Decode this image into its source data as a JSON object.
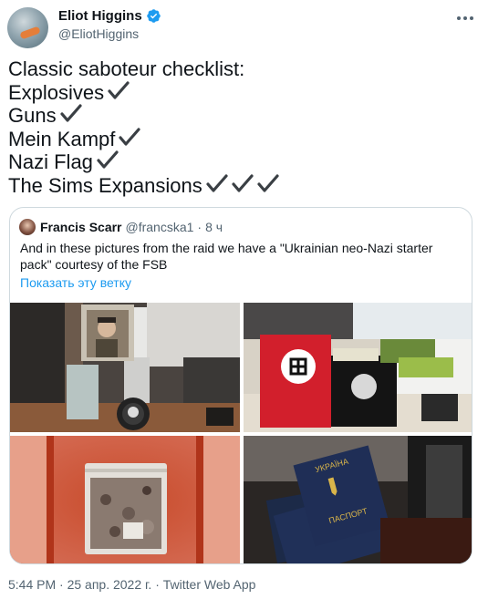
{
  "author": {
    "display_name": "Eliot Higgins",
    "handle": "@EliotHiggins",
    "verified": true,
    "more_icon": "more-horizontal-icon"
  },
  "tweet": {
    "lines": [
      {
        "text": "Classic saboteur checklist:",
        "checks": 0
      },
      {
        "text": "Explosives",
        "checks": 1
      },
      {
        "text": "Guns",
        "checks": 1
      },
      {
        "text": "Mein Kampf",
        "checks": 1
      },
      {
        "text": "Nazi Flag",
        "checks": 1
      },
      {
        "text": "The Sims Expansions",
        "checks": 3
      }
    ],
    "check_icon": "heavy-check-mark-icon"
  },
  "quote": {
    "display_name": "Francis Scarr",
    "handle": "@francska1",
    "separator": "·",
    "time": "8 ч",
    "text": "And in these pictures from the raid we have a \"Ukrainian neo-Nazi starter pack\" courtesy of the FSB",
    "show_thread": "Показать эту ветку",
    "photos": [
      {
        "name": "photo-book-and-patch"
      },
      {
        "name": "photo-flag-and-shirts"
      },
      {
        "name": "photo-bag"
      },
      {
        "name": "photo-passports",
        "passport_title_1": "УКРАЇНА",
        "passport_title_2": "ПАСПОРТ"
      }
    ]
  },
  "footer": {
    "time": "5:44 PM",
    "separator": "·",
    "date": "25 апр. 2022 г.",
    "source": "Twitter Web App"
  },
  "colors": {
    "text": "#0f1419",
    "secondary": "#536471",
    "accent": "#1d9bf0",
    "border": "#cfd9de"
  }
}
